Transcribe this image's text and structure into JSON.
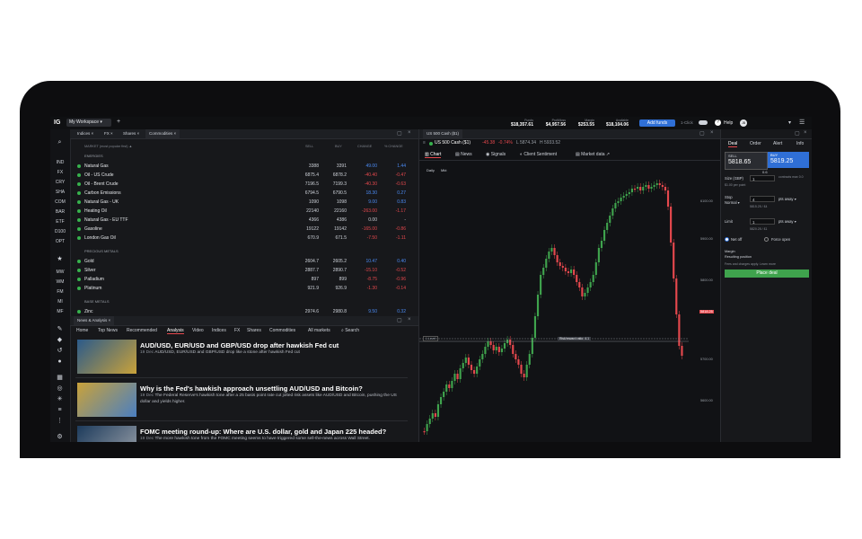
{
  "topbar": {
    "logo": "IG",
    "workspace": "My Workspace",
    "add_tab": "+",
    "metrics": [
      {
        "label": "Funds",
        "value": "$18,357.61"
      },
      {
        "label": "Profit/loss",
        "value": "$4,957.56"
      },
      {
        "label": "Margin",
        "value": "$253.55"
      },
      {
        "label": "Available",
        "value": "$18,104.06"
      }
    ],
    "add_funds": "Add funds",
    "one_click": "1-Click",
    "help": "Help",
    "avatar": "JB"
  },
  "sidebar": {
    "groups": [
      "IND",
      "FX",
      "CRY",
      "SHA",
      "COM",
      "BAR",
      "ETF",
      "D100",
      "OPT"
    ],
    "groups2": [
      "MW",
      "WM",
      "FM",
      "MI",
      "MF"
    ]
  },
  "markets": {
    "tabs": [
      "Indices",
      "FX",
      "Shares",
      "Commodities"
    ],
    "header": {
      "market": "MARKET (most popular first) ▲",
      "sell": "SELL",
      "buy": "BUY",
      "change": "CHANGE",
      "pct": "% CHANGE"
    },
    "sections": [
      {
        "title": "ENERGIES",
        "rows": [
          {
            "name": "Natural Gas",
            "sell": "3388",
            "buy": "3391",
            "change": "49.00",
            "pct": "1.44"
          },
          {
            "name": "Oil - US Crude",
            "sell": "6875.4",
            "buy": "6878.2",
            "change": "-40.40",
            "pct": "-0.47"
          },
          {
            "name": "Oil - Brent Crude",
            "sell": "7196.5",
            "buy": "7199.3",
            "change": "-40.30",
            "pct": "-0.63"
          },
          {
            "name": "Carbon Emissions",
            "sell": "6794.5",
            "buy": "6790.5",
            "change": "18.30",
            "pct": "0.27"
          },
          {
            "name": "Natural Gas - UK",
            "sell": "1090",
            "buy": "1098",
            "change": "9.00",
            "pct": "0.83"
          },
          {
            "name": "Heating Oil",
            "sell": "22140",
            "buy": "22160",
            "change": "-263.00",
            "pct": "-1.17"
          },
          {
            "name": "Natural Gas - EU TTF",
            "sell": "4366",
            "buy": "4386",
            "change": "0.00",
            "pct": "-"
          },
          {
            "name": "Gasoline",
            "sell": "19122",
            "buy": "19142",
            "change": "-165.00",
            "pct": "-0.86"
          },
          {
            "name": "London Gas Oil",
            "sell": "670.9",
            "buy": "671.5",
            "change": "-7.50",
            "pct": "-1.11"
          }
        ]
      },
      {
        "title": "PRECIOUS METALS",
        "rows": [
          {
            "name": "Gold",
            "sell": "2604.7",
            "buy": "2605.2",
            "change": "10.47",
            "pct": "0.40"
          },
          {
            "name": "Silver",
            "sell": "2887.7",
            "buy": "2890.7",
            "change": "-15.10",
            "pct": "-0.52"
          },
          {
            "name": "Palladium",
            "sell": "897",
            "buy": "899",
            "change": "-8.75",
            "pct": "-0.96"
          },
          {
            "name": "Platinum",
            "sell": "921.9",
            "buy": "926.9",
            "change": "-1.30",
            "pct": "-0.14"
          }
        ]
      },
      {
        "title": "BASE METALS",
        "rows": [
          {
            "name": "Zinc",
            "sell": "2974.6",
            "buy": "2980.8",
            "change": "9.50",
            "pct": "0.32"
          }
        ]
      }
    ]
  },
  "news": {
    "panel_title": "News & Analysis",
    "tabs": [
      "Home",
      "Top News",
      "Recommended",
      "Analysis",
      "Video",
      "Indices",
      "FX",
      "Shares",
      "Commodities",
      "All markets",
      "Search"
    ],
    "items": [
      {
        "title": "AUD/USD, EUR/USD and GBP/USD drop after hawkish Fed cut",
        "date": "19 Dec",
        "summary": "AUD/USD, EUR/USD and GBP/USD drop like a stone after hawkish Fed cut"
      },
      {
        "title": "Why is the Fed's hawkish approach unsettling AUD/USD and Bitcoin?",
        "date": "19 Dec",
        "summary": "The Federal Reserve's hawkish tone after a 25 basis point rate cut jolted risk assets like AUD/USD and Bitcoin, pushing the US dollar and yields higher."
      },
      {
        "title": "FOMC meeting round-up: Where are U.S. dollar, gold and Japan 225 headed?",
        "date": "19 Dec",
        "summary": "The more hawkish tone from the FOMC meeting seems to have triggered some sell-the-news across Wall Street."
      }
    ]
  },
  "chart": {
    "tab": "US 500 Cash ($1)",
    "instrument": "US 500 Cash ($1)",
    "change": "-45.38",
    "pct": "-0.74%",
    "low": "L 5874.34",
    "high": "H 5933.52",
    "subtabs": [
      "Chart",
      "News",
      "Signals",
      "Client Sentiment",
      "Market data"
    ],
    "timeframes": [
      "Daily",
      "Mkt"
    ],
    "current_price": "5818.25",
    "risk_label": "Risk/reward ratio: 4.1",
    "level_label": "1 Level",
    "y_axis": [
      "6100.00",
      "5900.00",
      "5800.00",
      "5700.00",
      "5600.00"
    ],
    "colors": {
      "up": "#3fa34d",
      "down": "#e5484d"
    },
    "chart_data": {
      "type": "candlestick",
      "series": "US 500 Cash ($1)",
      "ylim_labels": [
        "5600.00",
        "6100.00"
      ]
    }
  },
  "deal": {
    "tabs": [
      "Deal",
      "Order",
      "Alert",
      "Info"
    ],
    "sell_label": "SELL",
    "sell_price": "5818.65",
    "buy_label": "BUY",
    "buy_price": "5819.25",
    "spread": "0.6",
    "size_label": "Size (GBP)",
    "size_value": "1",
    "size_note": "$1.00 per point",
    "size_hint": "contracts max 0.0",
    "stop_label": "Stop",
    "stop_type": "Normal",
    "stop_value": "4",
    "stop_unit": "pts away",
    "stop_detail": "5815.25 / £4",
    "limit_label": "Limit",
    "limit_value": "1",
    "limit_unit": "pts away",
    "limit_detail": "5820.25 / £1",
    "net_off": "Net off",
    "force_open": "Force open",
    "margin": "Margin",
    "resulting": "Resulting position",
    "fees": "Fees and charges apply. Learn more",
    "place_deal": "Place deal"
  }
}
